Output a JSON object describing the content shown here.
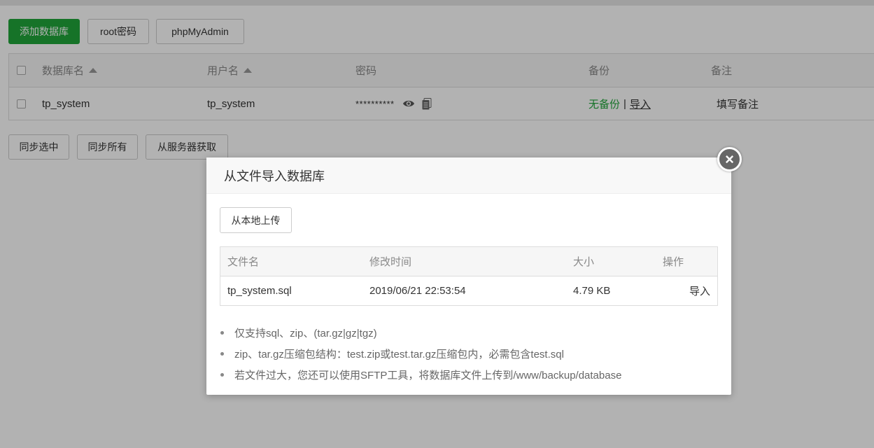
{
  "toolbar": {
    "add_db": "添加数据库",
    "root_pwd": "root密码",
    "phpmyadmin": "phpMyAdmin"
  },
  "table": {
    "headers": {
      "db_name": "数据库名",
      "username": "用户名",
      "password": "密码",
      "backup": "备份",
      "remark": "备注"
    },
    "rows": [
      {
        "db_name": "tp_system",
        "username": "tp_system",
        "password": "**********",
        "backup_status": "无备份",
        "backup_sep": "|",
        "import_link": "导入",
        "remark": "填写备注"
      }
    ]
  },
  "actions": {
    "sync_selected": "同步选中",
    "sync_all": "同步所有",
    "fetch_from_server": "从服务器获取"
  },
  "modal": {
    "title": "从文件导入数据库",
    "upload_local": "从本地上传",
    "close_glyph": "×",
    "file_table": {
      "headers": {
        "filename": "文件名",
        "modified": "修改时间",
        "size": "大小",
        "action": "操作"
      },
      "rows": [
        {
          "filename": "tp_system.sql",
          "modified": "2019/06/21 22:53:54",
          "size": "4.79 KB",
          "action": "导入"
        }
      ]
    },
    "notes": [
      "仅支持sql、zip、(tar.gz|gz|tgz)",
      "zip、tar.gz压缩包结构：test.zip或test.tar.gz压缩包内，必需包含test.sql",
      "若文件过大，您还可以使用SFTP工具，将数据库文件上传到/www/backup/database"
    ]
  },
  "colors": {
    "accent_green": "#20a53a"
  }
}
